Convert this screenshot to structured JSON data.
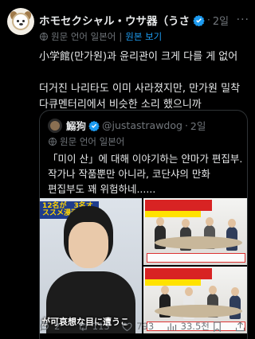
{
  "post": {
    "display_name": "ホモセクシャル・ウサ器（うさ…",
    "time": "2일",
    "translate": {
      "label": "원문 언어 일본어",
      "sep": "|",
      "view": "원본 보기"
    },
    "text_lines": [
      "小学館(만가원)과 윤리관이 크게 다를 게 없어",
      "",
      "더거진 나리타도 이미 사라졌지만, 만가원 밀착",
      "다큐멘터리에서 비슷한 소리 했으니까"
    ]
  },
  "quote": {
    "name": "鰯狗",
    "handle": "@justastrawdog",
    "time": "2일",
    "translate_label": "원문 언어 일본어",
    "text_lines": [
      "「미이 산」에 대해 이야기하는 얀마가 편집부.",
      "작가나 작품뿐만 아니라, 코단샤의 만화",
      "편집부도 꽤 위험하네......"
    ],
    "media": {
      "left_banner": "12名が　3名オススメ漫画",
      "left_caption": "が可哀想な目に遭うこ"
    }
  },
  "actions": {
    "replies": "2",
    "retweets": "113",
    "likes": "793",
    "views": "33.5천"
  },
  "colors": {
    "accent": "#1d9bf0",
    "muted": "#71767b",
    "text": "#e7e9ea",
    "background": "#000000"
  }
}
